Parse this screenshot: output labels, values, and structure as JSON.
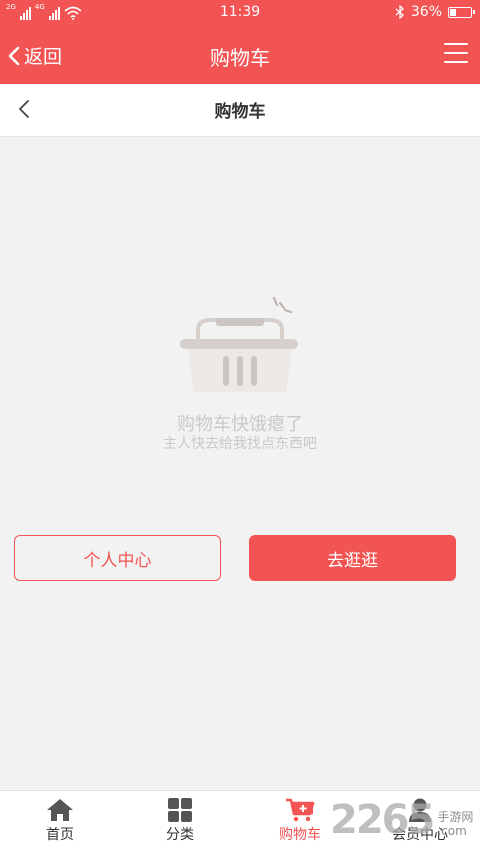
{
  "status_bar": {
    "signal_1": "2G",
    "signal_2": "4G",
    "time": "11:39",
    "battery_percent": "36%",
    "battery_level": 0.36,
    "icons": [
      "signal-icon",
      "wifi-icon",
      "bluetooth-icon",
      "battery-icon"
    ]
  },
  "app_header": {
    "back_label": "返回",
    "title": "购物车",
    "menu_icon": "menu-icon"
  },
  "sub_header": {
    "title": "购物车",
    "back_icon": "chevron-left-icon"
  },
  "empty_state": {
    "icon": "shopping-basket-icon",
    "title": "购物车快饿瘪了",
    "subtitle": "主人快去给我找点东西吧"
  },
  "actions": {
    "profile_button": "个人中心",
    "shop_button": "去逛逛"
  },
  "bottom_nav": {
    "items": [
      {
        "label": "首页",
        "icon": "home-icon",
        "active": false
      },
      {
        "label": "分类",
        "icon": "grid-icon",
        "active": false
      },
      {
        "label": "购物车",
        "icon": "cart-icon",
        "active": true
      },
      {
        "label": "会员中心",
        "icon": "user-icon",
        "active": false
      }
    ]
  },
  "watermark": {
    "number": "2265",
    "text_line1": "手游网",
    "text_line2": ".com"
  },
  "colors": {
    "accent": "#f25353",
    "background": "#f2f2f2",
    "empty_text": "#c9c9c9"
  }
}
